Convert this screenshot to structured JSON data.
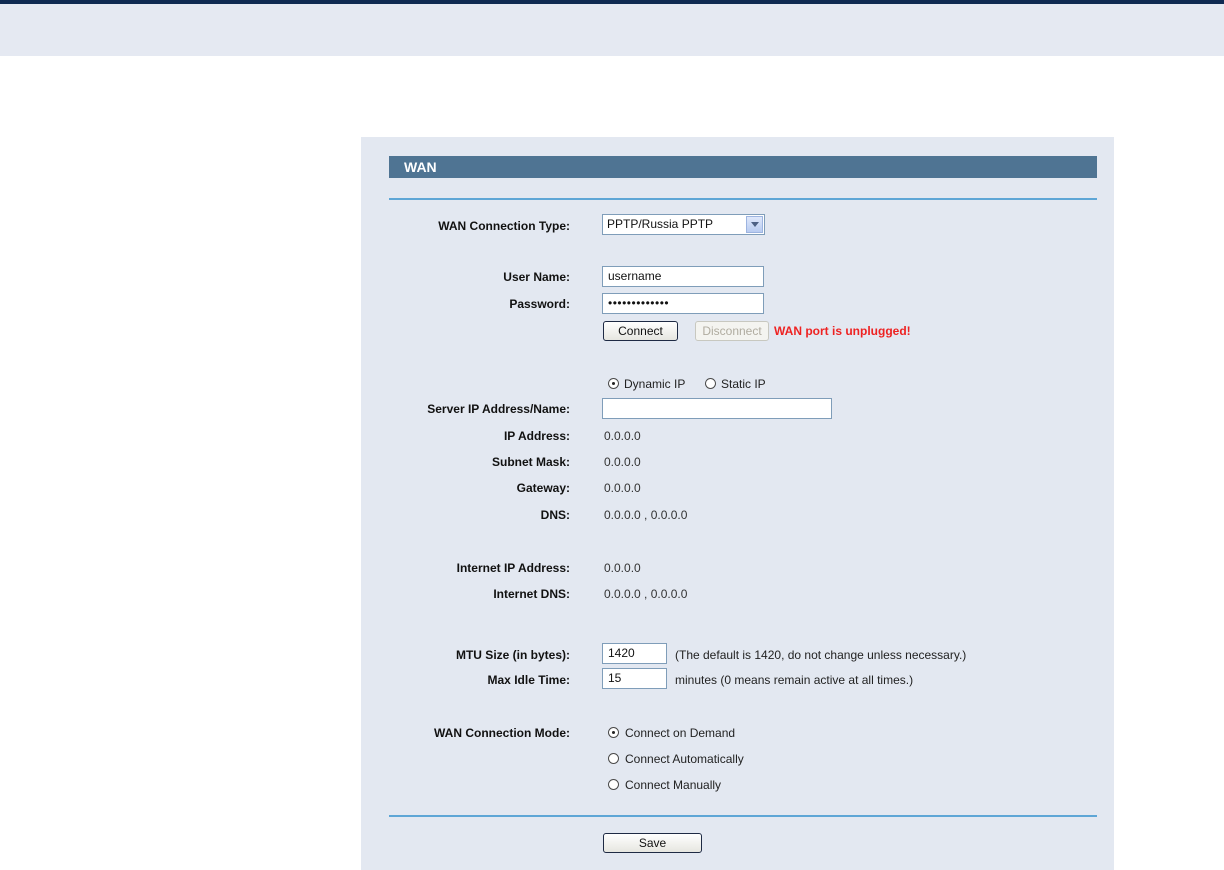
{
  "panel": {
    "title": "WAN"
  },
  "labels": {
    "wan_connection_type": "WAN Connection Type:",
    "user_name": "User Name:",
    "password": "Password:",
    "server_ip": "Server IP Address/Name:",
    "ip_address": "IP Address:",
    "subnet_mask": "Subnet Mask:",
    "gateway": "Gateway:",
    "dns": "DNS:",
    "internet_ip": "Internet IP Address:",
    "internet_dns": "Internet DNS:",
    "mtu": "MTU Size (in bytes):",
    "max_idle": "Max Idle Time:",
    "wan_mode": "WAN Connection Mode:"
  },
  "fields": {
    "connection_type": "PPTP/Russia PPTP",
    "user_name": "username",
    "password": "•••••••••••••",
    "server_ip": "",
    "mtu": "1420",
    "max_idle": "15"
  },
  "values": {
    "ip_address": "0.0.0.0",
    "subnet_mask": "0.0.0.0",
    "gateway": "0.0.0.0",
    "dns": "0.0.0.0 , 0.0.0.0",
    "internet_ip": "0.0.0.0",
    "internet_dns": "0.0.0.0 , 0.0.0.0"
  },
  "buttons": {
    "connect": "Connect",
    "disconnect": "Disconnect",
    "save": "Save"
  },
  "status": {
    "warning": "WAN port is unplugged!"
  },
  "ip_mode": {
    "dynamic": "Dynamic IP",
    "static": "Static IP",
    "selected": "dynamic"
  },
  "hints": {
    "mtu": "(The default is 1420, do not change unless necessary.)",
    "max_idle": "minutes (0 means remain active at all times.)"
  },
  "wan_modes": {
    "on_demand": "Connect on Demand",
    "automatically": "Connect Automatically",
    "manually": "Connect Manually",
    "selected": "on_demand"
  },
  "colors": {
    "header": "#4f7493",
    "warning": "#ee2222",
    "divider": "#5ea6d6"
  }
}
